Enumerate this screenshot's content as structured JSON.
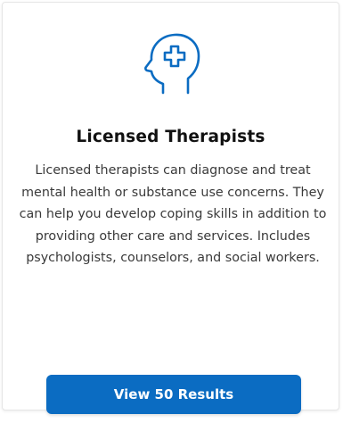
{
  "card": {
    "icon": "head-medical-cross-icon",
    "title": "Licensed Therapists",
    "description": "Licensed therapists can diagnose and treat mental health or substance use concerns. They can help you develop coping skills in addition to providing other care and services. Includes psychologists, counselors, and social workers.",
    "button_label": "View 50 Results"
  },
  "colors": {
    "accent": "#0b6cc2",
    "icon": "#0b6cc2",
    "title": "#111111",
    "body_text": "#3a3a3a"
  }
}
